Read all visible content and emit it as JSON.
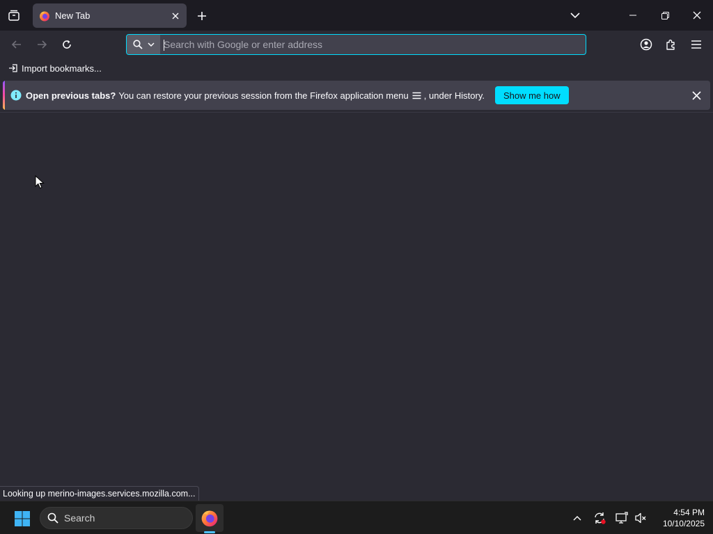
{
  "titlebar": {
    "tab": {
      "title": "New Tab"
    }
  },
  "navbar": {
    "url_placeholder": "Search with Google or enter address"
  },
  "bookmarks": {
    "import_label": "Import bookmarks..."
  },
  "notification": {
    "title": "Open previous tabs?",
    "message_before": "You can restore your previous session from the Firefox application menu",
    "message_after": ", under History.",
    "button_label": "Show me how"
  },
  "status_text": "Looking up merino-images.services.mozilla.com...",
  "taskbar": {
    "search_label": "Search",
    "clock": {
      "time": "4:54 PM",
      "date": "10/10/2025"
    }
  },
  "colors": {
    "accent": "#00ddff",
    "toolbar_bg": "#2b2a33",
    "titlebar_bg": "#1c1b22",
    "tab_bg": "#42414d",
    "taskbar_bg": "#1c1c1c"
  },
  "icons": [
    "tab-manager-icon",
    "firefox-icon",
    "close-icon",
    "plus-icon",
    "chevron-down-icon",
    "minimize-icon",
    "restore-icon",
    "back-arrow-icon",
    "forward-arrow-icon",
    "reload-icon",
    "search-icon",
    "account-icon",
    "extensions-icon",
    "hamburger-menu-icon",
    "import-icon",
    "info-icon",
    "windows-start-icon",
    "sync-icon",
    "display-icon",
    "volume-muted-icon"
  ]
}
